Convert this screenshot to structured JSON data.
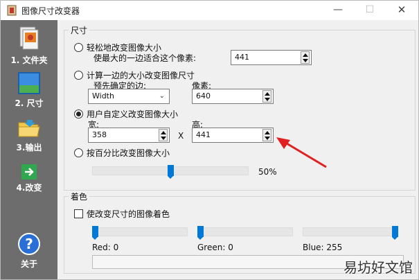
{
  "window": {
    "title": "图像尺寸改变器",
    "minimize": "—",
    "maximize": "☐",
    "close": "✕"
  },
  "sidebar": {
    "items": [
      {
        "label": "1. 文件夹",
        "icon": "folder-image-icon"
      },
      {
        "label": "2. 尺寸",
        "icon": "resize-image-icon"
      },
      {
        "label": "3.输出",
        "icon": "output-folder-icon"
      },
      {
        "label": "4.改变",
        "icon": "arrow-right-icon"
      },
      {
        "label": "关于",
        "icon": "help-icon"
      }
    ]
  },
  "size_group": {
    "title": "尺寸",
    "option_easy": {
      "label": "轻松地改变图像大小",
      "sublabel": "使最大的一边适合这个像素:",
      "value": "441"
    },
    "option_one_side": {
      "label": "计算一边的大小改变图像尺寸",
      "edge_label": "预先确定的边:",
      "edge_value": "Width",
      "pixels_label": "像素:",
      "pixels_value": "640"
    },
    "option_custom": {
      "label": "用户自定义改变图像大小",
      "width_label": "宽:",
      "width_value": "358",
      "x_label": "X",
      "height_label": "高:",
      "height_value": "441"
    },
    "option_percent": {
      "label": "按百分比改变图像大小",
      "percent_text": "50%",
      "percent": 50
    }
  },
  "tint_group": {
    "title": "着色",
    "checkbox_label": "使改变尺寸的图像着色",
    "red": {
      "label": "Red: 0",
      "value": 0
    },
    "green": {
      "label": "Green: 0",
      "value": 0
    },
    "blue": {
      "label": "Blue: 255",
      "value": 255
    }
  },
  "watermark": "易坊好文馆",
  "colors": {
    "accent": "#0078d7",
    "sidebar": "#6d6d6d",
    "arrow": "#e02020"
  }
}
